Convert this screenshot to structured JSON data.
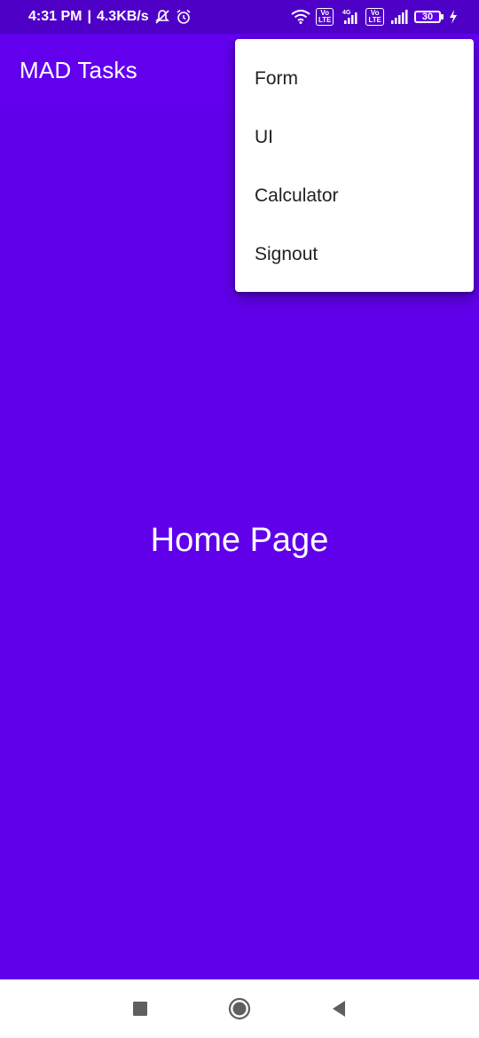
{
  "status_bar": {
    "time": "4:31 PM",
    "separator": "|",
    "net_speed": "4.3KB/s",
    "volte_1": "Vo\nLTE",
    "network_type": "4G",
    "volte_2": "Vo\nLTE",
    "battery_level": "30",
    "icons": [
      "mute-notifications-icon",
      "alarm-icon",
      "wifi-icon",
      "signal-icon",
      "battery-icon",
      "charging-icon"
    ]
  },
  "app_bar": {
    "title": "MAD Tasks"
  },
  "main": {
    "heading": "Home Page"
  },
  "menu": {
    "items": [
      {
        "label": "Form"
      },
      {
        "label": "UI"
      },
      {
        "label": "Calculator"
      },
      {
        "label": "Signout"
      }
    ]
  },
  "nav_bar": {
    "icons": [
      "recents-square-icon",
      "home-circle-icon",
      "back-triangle-icon"
    ]
  },
  "colors": {
    "primary": "#6200EE",
    "status_bar": "#4F00C7",
    "menu_bg": "#FFFFFF",
    "text_on_primary": "#FFFFFF"
  }
}
